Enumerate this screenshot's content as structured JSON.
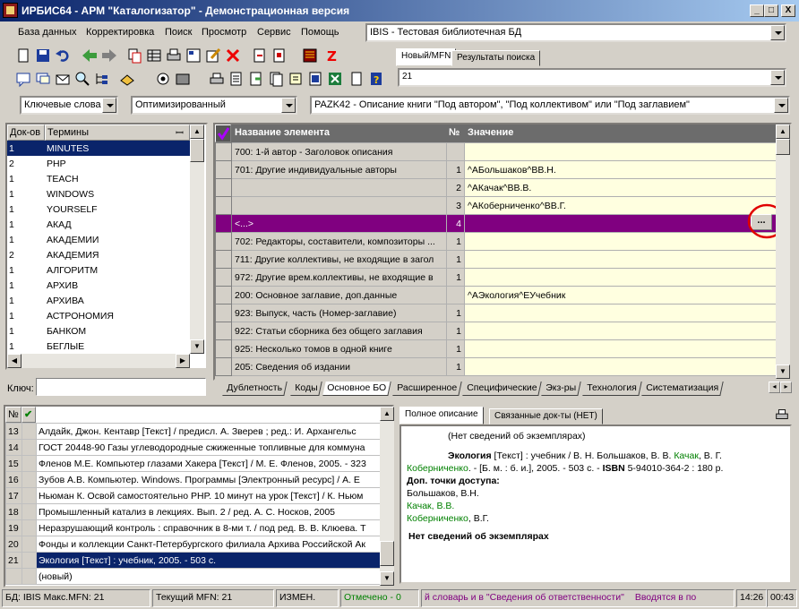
{
  "window": {
    "title": "ИРБИС64 - АРМ \"Каталогизатор\" - Демонстрационная версия",
    "min": "_",
    "max": "□",
    "close": "X"
  },
  "menu": [
    "База данных",
    "Корректировка",
    "Поиск",
    "Просмотр",
    "Сервис",
    "Помощь"
  ],
  "db_select": {
    "value": "IBIS - Тестовая библиотечная БД"
  },
  "right_tabs": [
    "Новый/MFN",
    "Результаты поиска"
  ],
  "mfn_input": {
    "value": "21"
  },
  "filters": {
    "dictionary": "Ключевые слова",
    "mode": "Оптимизированный",
    "worksheet": "PAZK42 - Описание книги \"Под автором\", \"Под коллективом\" или \"Под заглавием\""
  },
  "terms": {
    "headers": [
      "Док-ов",
      "Термины"
    ],
    "rows": [
      [
        "1",
        "MINUTES"
      ],
      [
        "2",
        "PHP"
      ],
      [
        "1",
        "TEACH"
      ],
      [
        "1",
        "WINDOWS"
      ],
      [
        "1",
        "YOURSELF"
      ],
      [
        "1",
        "АКАД"
      ],
      [
        "1",
        "АКАДЕМИИ"
      ],
      [
        "2",
        "АКАДЕМИЯ"
      ],
      [
        "1",
        "АЛГОРИТМ"
      ],
      [
        "1",
        "АРХИВ"
      ],
      [
        "1",
        "АРХИВА"
      ],
      [
        "1",
        "АСТРОНОМИЯ"
      ],
      [
        "1",
        "БАНКОМ"
      ],
      [
        "1",
        "БЕГЛЫЕ"
      ]
    ],
    "key_label": "Ключ:"
  },
  "editor": {
    "headers": [
      "Название элемента",
      "№",
      "Значение"
    ],
    "rows": [
      {
        "name": "700: 1-й автор - Заголовок описания",
        "num": "",
        "value": ""
      },
      {
        "name": "701: Другие индивидуальные авторы",
        "num": "1",
        "value": "^AБольшаков^BВ.Н."
      },
      {
        "name": "",
        "num": "2",
        "value": "^AКачак^BВ.В."
      },
      {
        "name": "",
        "num": "3",
        "value": "^AКоберниченко^BВ.Г."
      },
      {
        "name": "<...>",
        "num": "4",
        "value": ""
      },
      {
        "name": "702: Редакторы, составители, композиторы ...",
        "num": "1",
        "value": ""
      },
      {
        "name": "711: Другие коллективы, не входящие в загол",
        "num": "1",
        "value": ""
      },
      {
        "name": "972: Другие врем.коллективы, не входящие в",
        "num": "1",
        "value": ""
      },
      {
        "name": "200: Основное заглавие, доп.данные",
        "num": "",
        "value": "^AЭкология^EУчебник"
      },
      {
        "name": "923: Выпуск, часть (Номер-заглавие)",
        "num": "1",
        "value": ""
      },
      {
        "name": "922: Статьи сборника без общего заглавия",
        "num": "1",
        "value": ""
      },
      {
        "name": "925: Несколько томов в одной книге",
        "num": "1",
        "value": ""
      },
      {
        "name": "205: Сведения об издании",
        "num": "1",
        "value": ""
      }
    ],
    "ellipsis": "...",
    "tabs": [
      "Дублетность",
      "Коды",
      "Основное БО",
      "Расширенное",
      "Специфические",
      "Экз-ры",
      "Технология",
      "Систематизация"
    ]
  },
  "records": {
    "headers": [
      "№",
      "✔"
    ],
    "rows": [
      [
        "13",
        "Алдайк, Джон. Кентавр [Текст] / предисл. А. Зверев ; ред.: И. Архангельс"
      ],
      [
        "14",
        "ГОСТ 20448-90 Газы углеводородные сжиженные топливные для коммуна"
      ],
      [
        "15",
        "Фленов М.Е. Компьютер глазами Хакера [Текст] / М. Е. Фленов, 2005. - 323"
      ],
      [
        "16",
        "Зубов А.В. Компьютер. Windows. Программы [Электронный ресурс] / А. Е"
      ],
      [
        "17",
        "Ньюман К. Освой самостоятельно PHP. 10 минут на урок [Текст] / К. Ньюм"
      ],
      [
        "18",
        "Промышленный катализ в лекциях. Вып. 2 / ред. А. С. Носков, 2005"
      ],
      [
        "19",
        "Неразрушающий контроль : справочник в 8-ми т. / под ред. В. В. Клюева. Т"
      ],
      [
        "20",
        "Фонды и коллекции Санкт-Петербургского филиала Архива Российской Ак"
      ],
      [
        "21",
        "Экология [Текст] : учебник, 2005. - 503 с."
      ],
      [
        "",
        "(новый)"
      ]
    ]
  },
  "description": {
    "tabs": [
      "Полное описание",
      "Связанные док-ты (НЕТ)"
    ],
    "no_copies_top": "(Нет сведений об экземплярах)",
    "title_bold": "Экология",
    "title_rest": " [Текст] : учебник / В. Н. Большаков, В. В. ",
    "a2": "Качак",
    "comma": ", В. Г.",
    "a3": "Коберниченко",
    "imprint": ". - [Б. м. : б. и.], 2005. - 503 с. - ",
    "isbn_label": "ISBN",
    "isbn_rest": " 5-94010-364-2 : 180 р.",
    "access_label": "Доп. точки доступа:",
    "acc1": "Большаков, В.Н.",
    "acc2": "Качак, В.В.",
    "acc3a": "Коберниченко",
    "acc3b": ", В.Г.",
    "no_copies_bottom": "Нет сведений об экземплярах"
  },
  "status": {
    "db": "БД: IBIS Макс.MFN: 21",
    "current": "Текущий MFN: 21",
    "changed": "ИЗМЕН.",
    "marked": "Отмечено - 0",
    "hint1": "й словарь и в \"Сведения об ответственности\"",
    "hint2": "Вводятся в по",
    "time": "14:26",
    "elapsed": "00:43"
  },
  "colors": {
    "selection": "#0a246a",
    "edit_highlight": "#800080",
    "value_bg": "#ffffe0",
    "marker": "#e00000",
    "link_green": "#008000"
  }
}
